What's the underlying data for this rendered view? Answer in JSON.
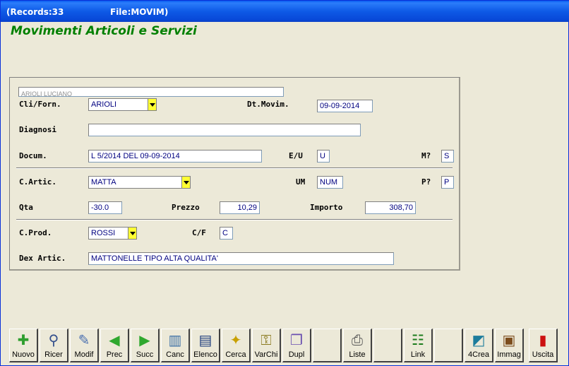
{
  "titlebar": {
    "records": "(Records:33",
    "file": "File:MOVIM)"
  },
  "form": {
    "title": "Movimenti Articoli e Servizi"
  },
  "header_name": "ARIOLI LUCIANO",
  "fields": {
    "cli_forn": {
      "label": "Cli/Forn.",
      "value": "ARIOLI"
    },
    "dt_movim": {
      "label": "Dt.Movim.",
      "value": "09-09-2014"
    },
    "diagnosi": {
      "label": "Diagnosi",
      "value": ""
    },
    "docum": {
      "label": "Docum.",
      "value": "L 5/2014 DEL 09-09-2014"
    },
    "e_u": {
      "label": "E/U",
      "value": "U"
    },
    "m": {
      "label": "M?",
      "value": "S"
    },
    "c_artic": {
      "label": "C.Artic.",
      "value": "MATTA"
    },
    "um": {
      "label": "UM",
      "value": "NUM"
    },
    "p": {
      "label": "P?",
      "value": "P"
    },
    "qta": {
      "label": "Qta",
      "value": "-30.0"
    },
    "prezzo": {
      "label": "Prezzo",
      "value": "10,29"
    },
    "importo": {
      "label": "Importo",
      "value": "308,70"
    },
    "c_prod": {
      "label": "C.Prod.",
      "value": "ROSSI"
    },
    "c_f": {
      "label": "C/F",
      "value": "C"
    },
    "dex_artic": {
      "label": "Dex Artic.",
      "value": "MATTONELLE TIPO ALTA QUALITA'"
    }
  },
  "toolbar": [
    {
      "label": "Nuovo",
      "icon": "new-icon"
    },
    {
      "label": "Ricer",
      "icon": "search-icon"
    },
    {
      "label": "Modif",
      "icon": "edit-icon"
    },
    {
      "label": "Prec",
      "icon": "arrow-left-icon"
    },
    {
      "label": "Succ",
      "icon": "arrow-right-icon"
    },
    {
      "label": "Canc",
      "icon": "trash-icon"
    },
    {
      "label": "Elenco",
      "icon": "list-icon"
    },
    {
      "label": "Cerca",
      "icon": "find-icon"
    },
    {
      "label": "VarChi",
      "icon": "keys-icon"
    },
    {
      "label": "Dupl",
      "icon": "duplicate-icon"
    },
    {
      "label": "",
      "icon": ""
    },
    {
      "label": "Liste",
      "icon": "printer-icon"
    },
    {
      "label": "",
      "icon": ""
    },
    {
      "label": "Link",
      "icon": "link-icon"
    },
    {
      "label": "",
      "icon": ""
    },
    {
      "label": "4Crea",
      "icon": "create-icon"
    },
    {
      "label": "Immag",
      "icon": "image-icon"
    },
    {
      "label": "",
      "icon": ""
    },
    {
      "label": "Uscita",
      "icon": "exit-door-icon"
    }
  ],
  "colors": {
    "title_green": "#008000",
    "field_text": "#000080",
    "combo_arrow": "#ffff33"
  }
}
